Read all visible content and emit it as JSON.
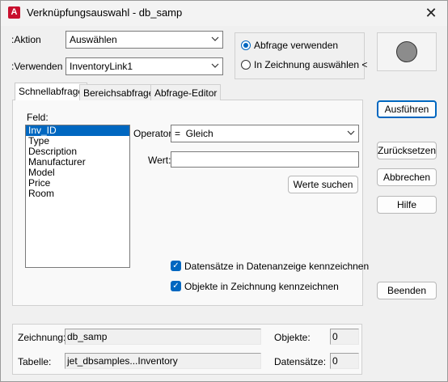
{
  "window": {
    "title": "Verknüpfungsauswahl - db_samp",
    "app_icon": "A"
  },
  "top": {
    "aktion_label": ":Aktion",
    "aktion_value": "Auswählen",
    "verwenden_label": ":Verwenden",
    "verwenden_value": "InventoryLink1",
    "radio_abfrage": "Abfrage verwenden",
    "radio_zeichnung": "In Zeichnung auswählen <"
  },
  "tabs": [
    "Schnellabfrage",
    "Bereichsabfrage",
    "Abfrage-Editor"
  ],
  "quick": {
    "feld_label": "Feld:",
    "fields": [
      "Inv_ID",
      "Type",
      "Description",
      "Manufacturer",
      "Model",
      "Price",
      "Room"
    ],
    "selected_field": "Inv_ID",
    "operator_label": "Operator:",
    "operator_value": "=  Gleich",
    "wert_label": "Wert:",
    "wert_value": "",
    "werte_suchen": "Werte suchen",
    "check1": "Datensätze in Datenanzeige kennzeichnen",
    "check2": "Objekte in Zeichnung kennzeichnen"
  },
  "buttons": {
    "ausfuehren": "Ausführen",
    "zuruecksetzen": "Zurücksetzen",
    "abbrechen": "Abbrechen",
    "hilfe": "Hilfe",
    "beenden": "Beenden"
  },
  "status": {
    "zeichnung_label": "Zeichnung:",
    "zeichnung_value": "db_samp",
    "tabelle_label": "Tabelle:",
    "tabelle_value": "jet_dbsamples...Inventory",
    "objekte_label": "Objekte:",
    "objekte_value": "0",
    "datensaetze_label": "Datensätze:",
    "datensaetze_value": "0"
  }
}
